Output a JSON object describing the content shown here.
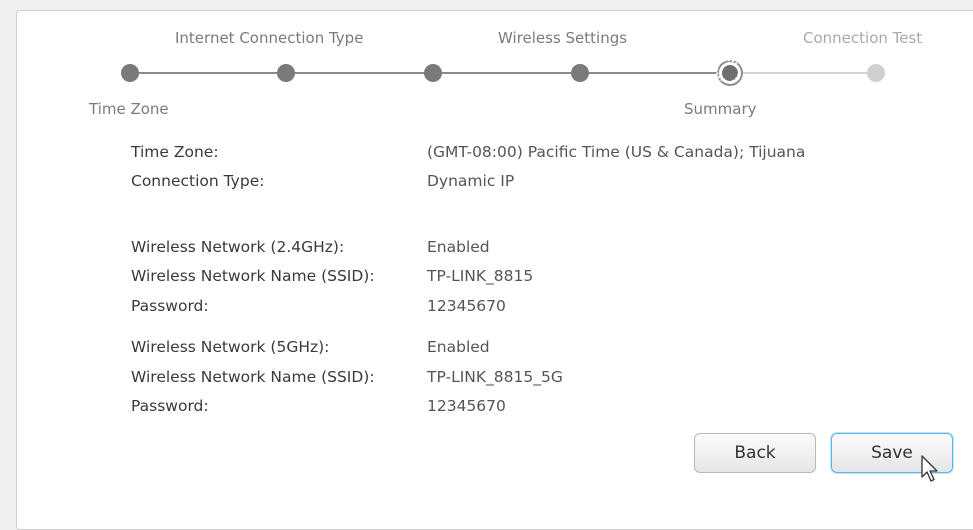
{
  "wizard": {
    "steps_top": [
      "Internet Connection Type",
      "Wireless Settings",
      "Connection Test"
    ],
    "steps_bottom": [
      "Time Zone",
      "Summary"
    ]
  },
  "summary": {
    "rows": [
      {
        "label": "Time Zone:",
        "value": "(GMT-08:00) Pacific Time (US & Canada); Tijuana"
      },
      {
        "label": "Connection Type:",
        "value": "Dynamic IP"
      },
      {
        "label": "Wireless Network (2.4GHz):",
        "value": "Enabled"
      },
      {
        "label": "Wireless Network Name (SSID):",
        "value": "TP-LINK_8815"
      },
      {
        "label": "Password:",
        "value": "12345670"
      },
      {
        "label": "Wireless Network (5GHz):",
        "value": "Enabled"
      },
      {
        "label": "Wireless Network Name (SSID):",
        "value": "TP-LINK_8815_5G"
      },
      {
        "label": "Password:",
        "value": "12345670"
      }
    ]
  },
  "buttons": {
    "back": "Back",
    "save": "Save"
  },
  "colors": {
    "save_border": "#57b7e0",
    "step_done": "#7a7a7a",
    "step_pending": "#cfcfcf"
  }
}
